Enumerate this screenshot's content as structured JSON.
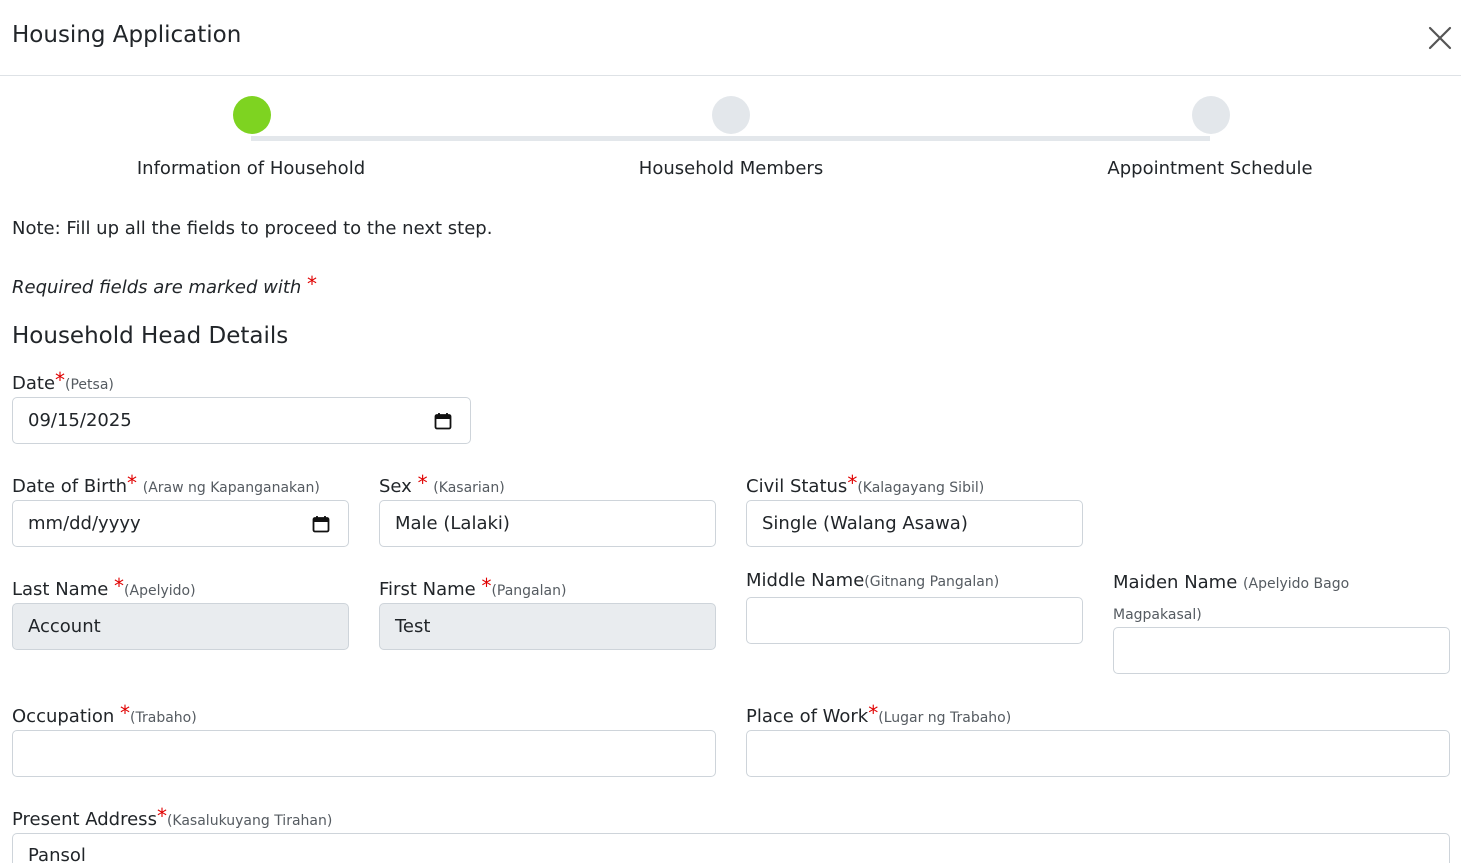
{
  "modal": {
    "title": "Housing Application"
  },
  "stepper": {
    "steps": [
      {
        "label": "Information of Household",
        "active": true
      },
      {
        "label": "Household Members",
        "active": false
      },
      {
        "label": "Appointment Schedule",
        "active": false
      }
    ],
    "active_color": "#7ed321",
    "inactive_color": "#e3e7eb"
  },
  "notes": {
    "fill_up": "Note: Fill up all the fields to proceed to the next step.",
    "required": "Required fields are marked with",
    "required_marker": "*"
  },
  "section": {
    "title": "Household Head Details"
  },
  "fields": {
    "date": {
      "label": "Date",
      "hint": "(Petsa)",
      "value": "09/15/2025"
    },
    "birth": {
      "label": "Date of Birth",
      "hint": "(Araw ng Kapanganakan)",
      "value": "mm/dd/yyyy"
    },
    "sex": {
      "label": "Sex ",
      "hint": "(Kasarian)",
      "value": "Male (Lalaki)"
    },
    "civil": {
      "label": "Civil Status",
      "hint": "(Kalagayang Sibil)",
      "value": "Single (Walang Asawa)"
    },
    "last_name": {
      "label": "Last Name ",
      "hint": "(Apelyido)",
      "value": "Account"
    },
    "first_name": {
      "label": "First Name ",
      "hint": "(Pangalan)",
      "value": "Test"
    },
    "middle_name": {
      "label": "Middle Name",
      "hint": "(Gitnang Pangalan)",
      "value": ""
    },
    "maiden_name": {
      "label": "Maiden Name ",
      "hint": "(Apelyido Bago Magpakasal)",
      "value": ""
    },
    "occupation": {
      "label": "Occupation ",
      "hint": "(Trabaho)",
      "value": ""
    },
    "place_of_work": {
      "label": "Place of Work",
      "hint": "(Lugar ng Trabaho)",
      "value": ""
    },
    "address": {
      "label": "Present Address",
      "hint": "(Kasalukuyang Tirahan)",
      "value": "Pansol"
    }
  },
  "required_marker": "*",
  "colors": {
    "required": "#e00000",
    "readonly_bg": "#e9ecef"
  },
  "icons": {
    "close": "close-icon",
    "calendar": "calendar-icon"
  }
}
